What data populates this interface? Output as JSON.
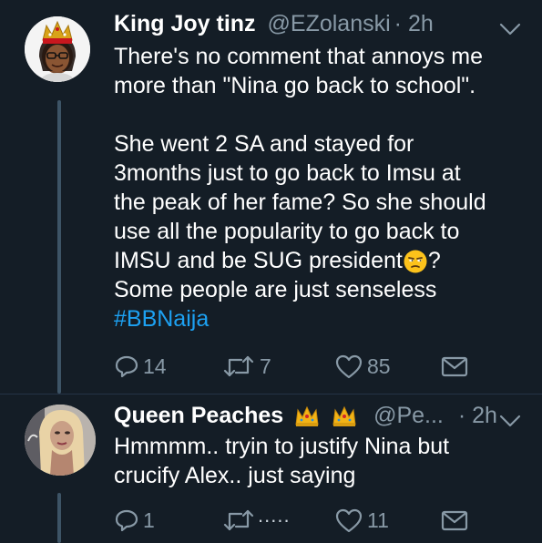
{
  "tweets": [
    {
      "name": "King Joy tinz",
      "handle": "@EZolanski",
      "time": "· 2h",
      "lines": [
        "There's no comment that annoys me",
        "more than \"Nina go back to school\"."
      ],
      "paragraph2": [
        "She went 2 SA and stayed for",
        "3months just to go back to Imsu at",
        "the peak of her fame? So she should",
        "use all the popularity to go back to"
      ],
      "line_president": "IMSU and be SUG president",
      "after_emoji": "?",
      "line_last": "Some people are just senseless",
      "hashtag": "#BBNaija",
      "emoji": "unamused-face",
      "stats": {
        "replies": "14",
        "retweets": "7",
        "likes": "85"
      }
    },
    {
      "name": "Queen Peaches",
      "handle": "@Pe...",
      "time": "· 2h",
      "name_decorations": [
        "crown-emoji",
        "crown-emoji"
      ],
      "lines": [
        "Hmmmm.. tryin to justify Nina but",
        "crucify Alex.. just saying"
      ],
      "stats": {
        "replies": "1",
        "retweets": "",
        "likes": "11"
      },
      "loading_indicator": "....."
    }
  ],
  "icons": {
    "reply": "reply-icon",
    "retweet": "retweet-icon",
    "like": "heart-icon",
    "dm": "envelope-icon",
    "menu": "chevron-down-icon"
  },
  "colors": {
    "background": "#141d26",
    "secondary_text": "#8899a6",
    "link": "#1da1f2",
    "thread_line": "#3d5466"
  }
}
